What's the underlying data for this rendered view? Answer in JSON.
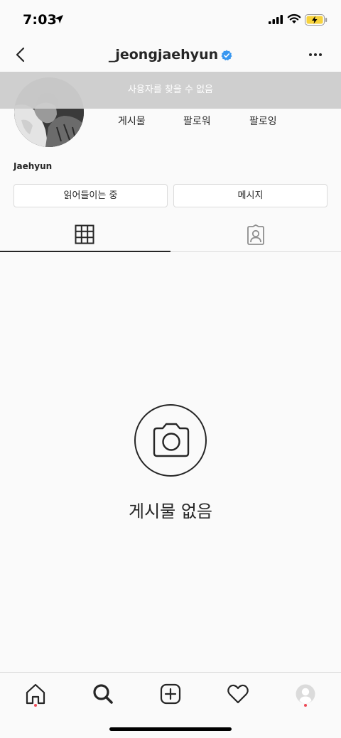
{
  "status_bar": {
    "time": "7:03"
  },
  "header": {
    "username": "_jeongjaehyun"
  },
  "banner": {
    "text": "사용자를 찾을 수 없음"
  },
  "profile": {
    "display_name": "Jaehyun",
    "stats": {
      "posts_label": "게시물",
      "followers_label": "팔로워",
      "following_label": "팔로잉"
    },
    "buttons": {
      "follow_label": "읽어들이는 중",
      "message_label": "메시지"
    }
  },
  "empty_state": {
    "text": "게시물 없음"
  },
  "colors": {
    "verified": "#3897f0",
    "notification_dot": "#ed4956",
    "banner_bg": "#cdcdcd"
  },
  "icons": {
    "nav": [
      "back-icon",
      "verified-badge-icon",
      "more-icon"
    ],
    "tabs": [
      "grid-icon",
      "tagged-icon"
    ],
    "bottom_nav": [
      "home-icon",
      "search-icon",
      "add-icon",
      "heart-icon",
      "profile-avatar-icon"
    ]
  }
}
